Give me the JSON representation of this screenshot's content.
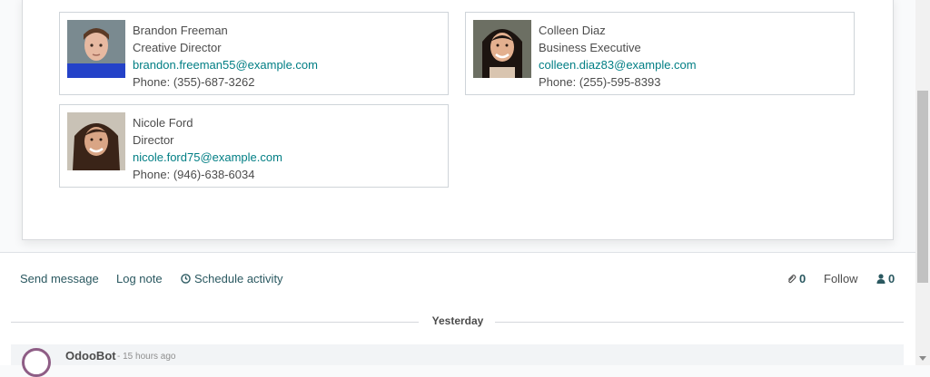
{
  "contacts": [
    {
      "name": "Brandon Freeman",
      "title": "Creative Director",
      "email": "brandon.freeman55@example.com",
      "phone": "Phone: (355)-687-3262"
    },
    {
      "name": "Colleen Diaz",
      "title": "Business Executive",
      "email": "colleen.diaz83@example.com",
      "phone": "Phone: (255)-595-8393"
    },
    {
      "name": "Nicole Ford",
      "title": "Director",
      "email": "nicole.ford75@example.com",
      "phone": "Phone: (946)-638-6034"
    }
  ],
  "chatter": {
    "send_message": "Send message",
    "log_note": "Log note",
    "schedule_activity": "Schedule activity",
    "attachments_count": "0",
    "follow": "Follow",
    "followers_count": "0"
  },
  "messages": {
    "separator": "Yesterday",
    "items": [
      {
        "author": "OdooBot",
        "time": "- 15 hours ago"
      }
    ]
  },
  "colors": {
    "accent": "#017e84",
    "link_dark": "#2a5860",
    "bot": "#8e5d85"
  }
}
